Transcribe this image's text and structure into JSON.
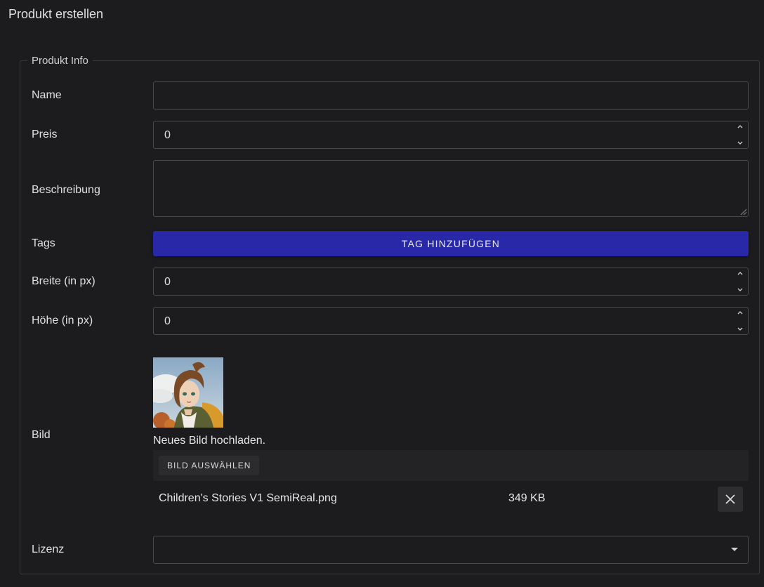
{
  "page": {
    "title": "Produkt erstellen"
  },
  "product_info": {
    "legend": "Produkt Info",
    "name": {
      "label": "Name",
      "value": ""
    },
    "price": {
      "label": "Preis",
      "value": "0"
    },
    "description": {
      "label": "Beschreibung",
      "value": ""
    },
    "tags": {
      "label": "Tags",
      "add_button": "TAG HINZUFÜGEN"
    },
    "width": {
      "label": "Breite (in px)",
      "value": "0"
    },
    "height": {
      "label": "Höhe (in px)",
      "value": "0"
    },
    "image": {
      "label": "Bild",
      "upload_hint": "Neues Bild hochladen.",
      "choose_button": "BILD AUSWÄHLEN",
      "file": {
        "name": "Children's Stories V1 SemiReal.png",
        "size": "349 KB"
      }
    },
    "license": {
      "label": "Lizenz",
      "value": ""
    }
  },
  "colors": {
    "background": "#1c1c1e",
    "accent": "#2828a8",
    "border": "#4a4a4c"
  },
  "icons": {
    "spinner_up": "chevron-up-icon",
    "spinner_down": "chevron-down-icon",
    "remove": "close-icon",
    "dropdown": "caret-down-icon"
  }
}
